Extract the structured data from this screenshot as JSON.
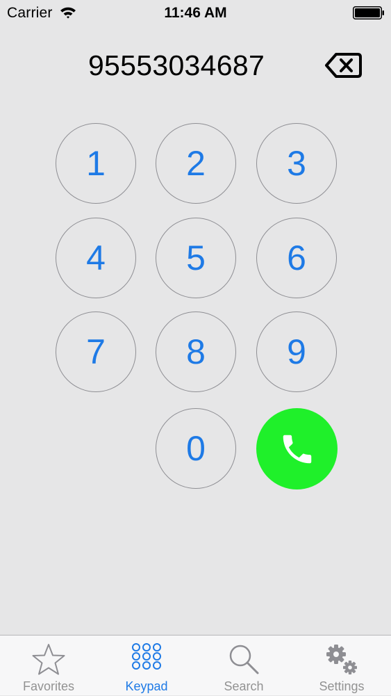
{
  "status_bar": {
    "carrier": "Carrier",
    "time": "11:46 AM",
    "icons": [
      "wifi-icon",
      "battery-icon"
    ]
  },
  "dialer": {
    "number": "95553034687",
    "backspace_icon": "backspace-icon"
  },
  "keypad": {
    "keys": [
      "1",
      "2",
      "3",
      "4",
      "5",
      "6",
      "7",
      "8",
      "9",
      "0"
    ],
    "call_icon": "phone-icon",
    "call_color": "#1ff02a",
    "digit_color": "#1e7ae6"
  },
  "tabs": [
    {
      "label": "Favorites",
      "icon": "star-icon",
      "active": false
    },
    {
      "label": "Keypad",
      "icon": "keypad-icon",
      "active": true
    },
    {
      "label": "Search",
      "icon": "search-icon",
      "active": false
    },
    {
      "label": "Settings",
      "icon": "gear-icon",
      "active": false
    }
  ],
  "colors": {
    "background": "#e6e6e7",
    "accent": "#1e7ae6",
    "tab_inactive": "#929292"
  }
}
